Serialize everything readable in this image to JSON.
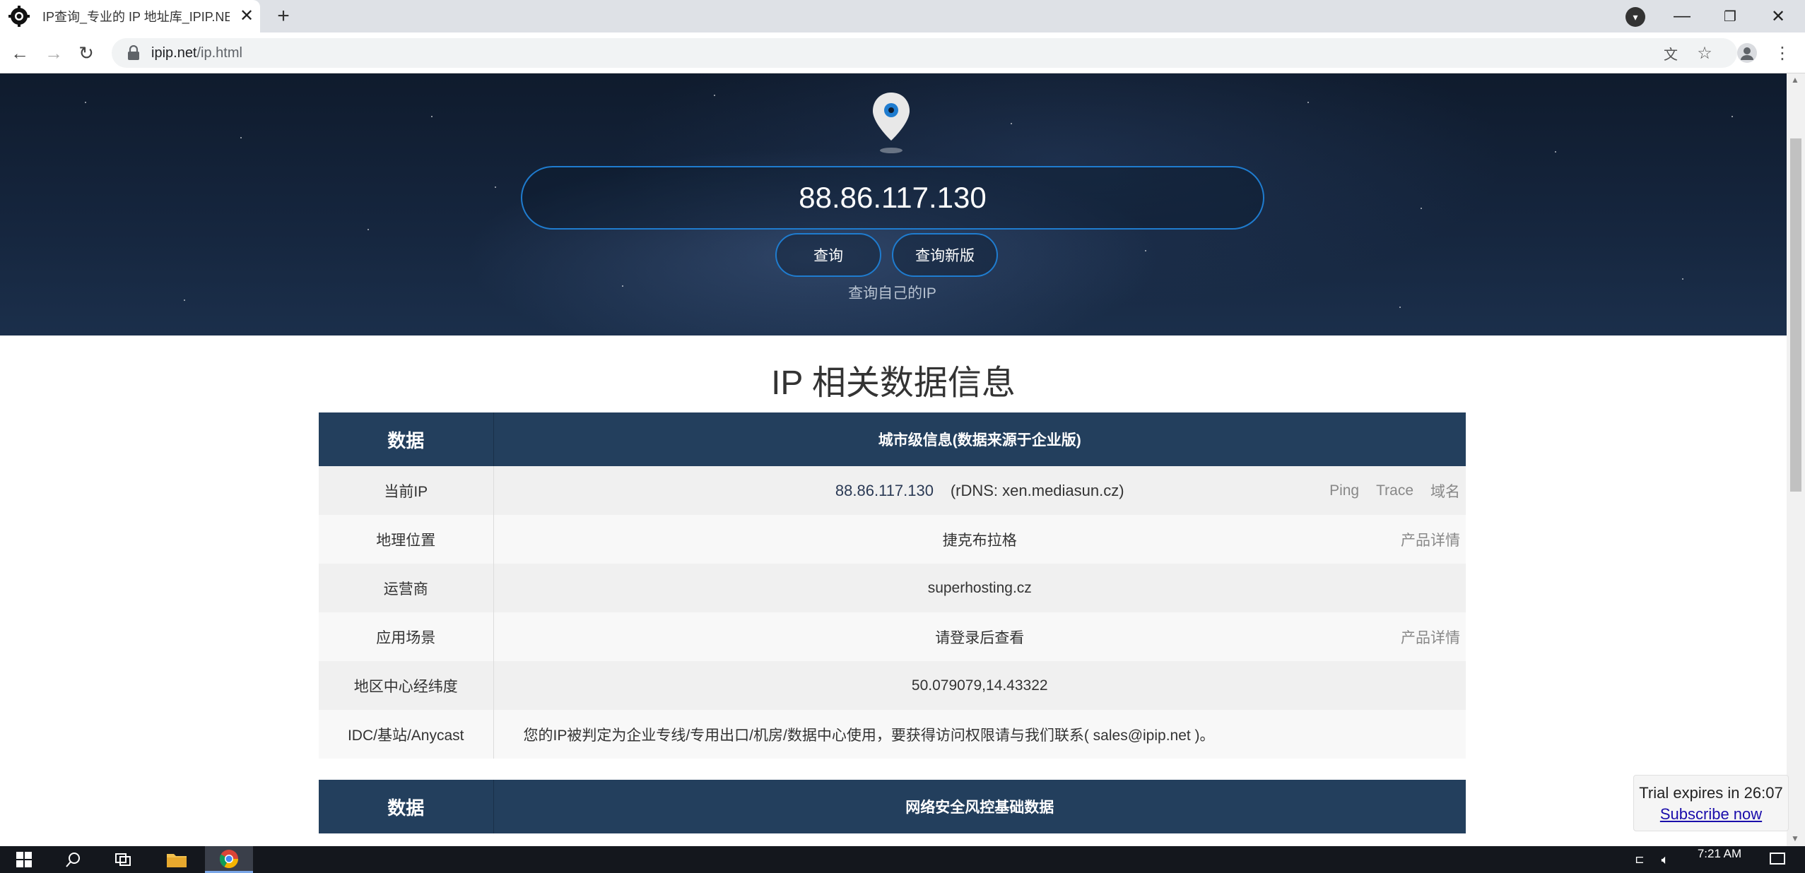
{
  "browser": {
    "tab_title": "IP查询_专业的 IP 地址库_IPIP.NET",
    "url_host": "ipip.net",
    "url_path": "/ip.html"
  },
  "hero": {
    "ip_value": "88.86.117.130",
    "query_button": "查询",
    "query_new_button": "查询新版",
    "self_ip_link": "查询自己的IP"
  },
  "section": {
    "title": "IP 相关数据信息"
  },
  "table1": {
    "header_left": "数据",
    "header_right": "城市级信息(数据来源于企业版)",
    "rows": [
      {
        "label": "当前IP",
        "ip": "88.86.117.130",
        "rdns": "(rDNS: xen.mediasun.cz)",
        "links": [
          "Ping",
          "Trace",
          "域名"
        ]
      },
      {
        "label": "地理位置",
        "value": "捷克布拉格",
        "link": "产品详情"
      },
      {
        "label": "运营商",
        "value": "superhosting.cz"
      },
      {
        "label": "应用场景",
        "value": "请登录后查看",
        "link": "产品详情"
      },
      {
        "label": "地区中心经纬度",
        "value": "50.079079,14.43322"
      },
      {
        "label": "IDC/基站/Anycast",
        "value": "您的IP被判定为企业专线/专用出口/机房/数据中心使用，要获得访问权限请与我们联系( sales@ipip.net )。"
      }
    ]
  },
  "table2": {
    "header_left": "数据",
    "header_right": "网络安全风控基础数据"
  },
  "trial": {
    "text": "Trial expires in 26:07",
    "link": "Subscribe now"
  },
  "taskbar": {
    "time": "7:21 AM"
  },
  "colors": {
    "table_header": "#233f5d",
    "hero_border": "#1f7ccf"
  }
}
